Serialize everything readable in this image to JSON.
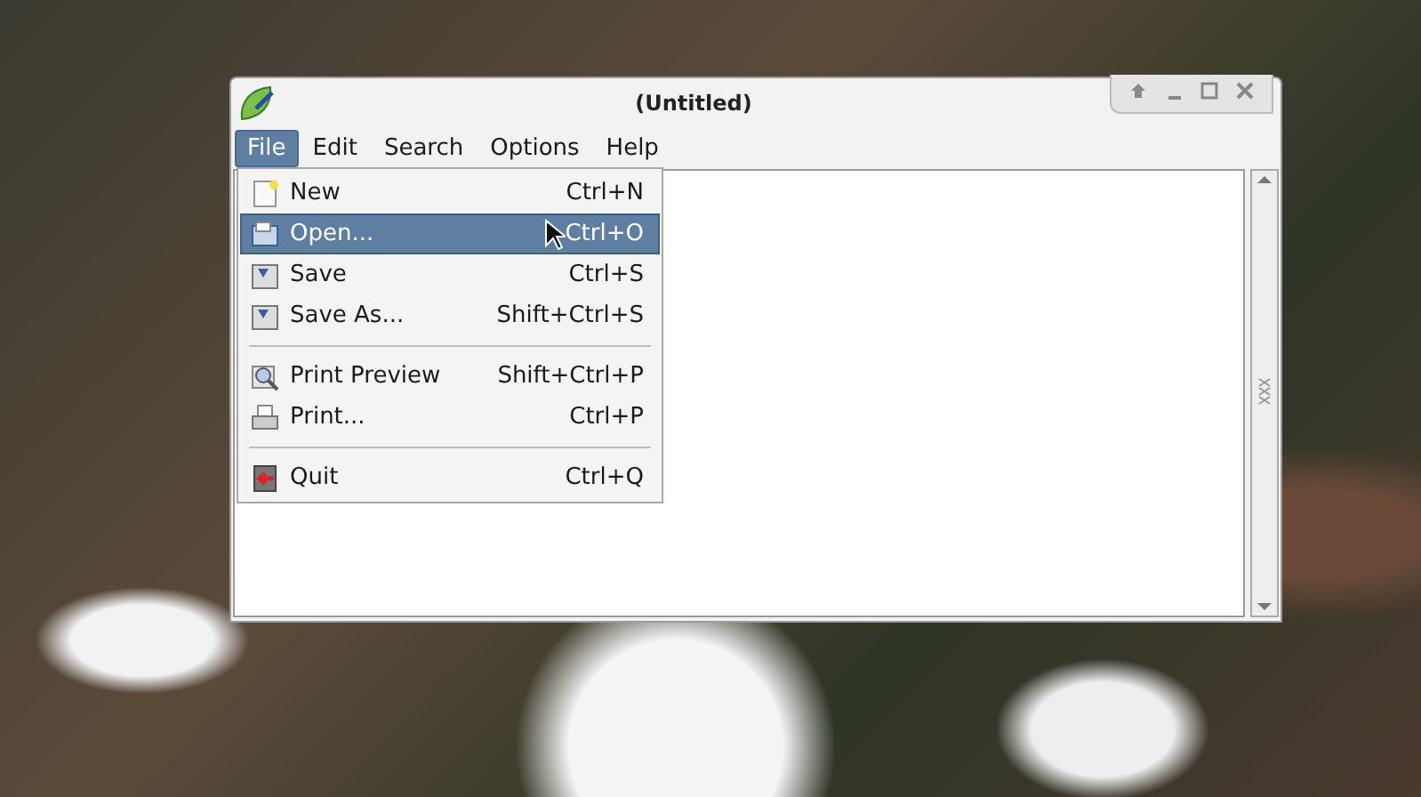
{
  "window": {
    "title": "(Untitled)"
  },
  "menubar": [
    {
      "label": "File",
      "selected": true
    },
    {
      "label": "Edit",
      "selected": false
    },
    {
      "label": "Search",
      "selected": false
    },
    {
      "label": "Options",
      "selected": false
    },
    {
      "label": "Help",
      "selected": false
    }
  ],
  "menu": {
    "items": [
      {
        "kind": "item",
        "label": "New",
        "shortcut": "Ctrl+N",
        "selected": false
      },
      {
        "kind": "item",
        "label": "Open...",
        "shortcut": "Ctrl+O",
        "selected": true
      },
      {
        "kind": "item",
        "label": "Save",
        "shortcut": "Ctrl+S",
        "selected": false
      },
      {
        "kind": "item",
        "label": "Save As...",
        "shortcut": "Shift+Ctrl+S",
        "selected": false
      },
      {
        "kind": "separator"
      },
      {
        "kind": "item",
        "label": "Print Preview",
        "shortcut": "Shift+Ctrl+P",
        "selected": false
      },
      {
        "kind": "item",
        "label": "Print...",
        "shortcut": "Ctrl+P",
        "selected": false
      },
      {
        "kind": "separator"
      },
      {
        "kind": "item",
        "label": "Quit",
        "shortcut": "Ctrl+Q",
        "selected": false
      }
    ]
  }
}
